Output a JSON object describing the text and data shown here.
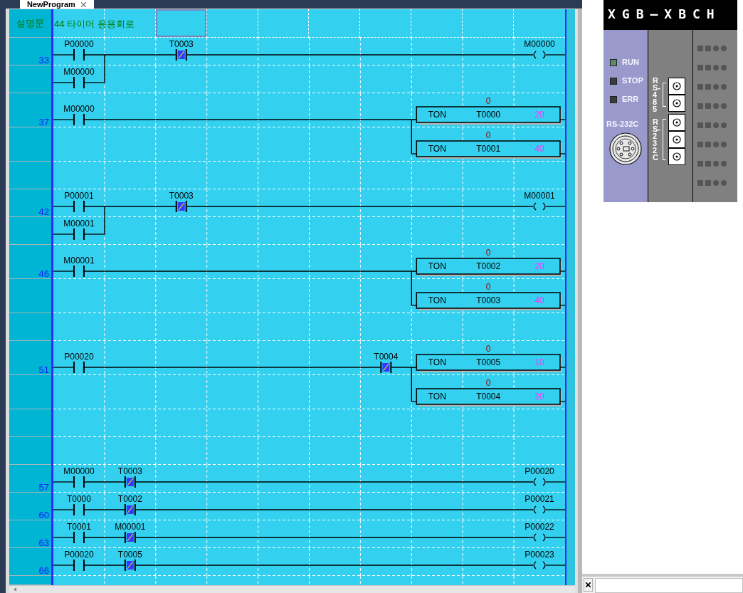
{
  "tab": {
    "title": "NewProgram",
    "selected": true
  },
  "ladder": {
    "rows": [
      {
        "kind": "comment",
        "label": "설명문",
        "text": "44 타이머 응용회로",
        "cells": [
          {
            "kind": "blank",
            "selected": false
          },
          {
            "kind": "blank",
            "selected": false
          },
          {
            "kind": "blank",
            "selected": true
          },
          {
            "kind": "blank",
            "selected": false
          },
          {
            "kind": "blank",
            "selected": false
          },
          {
            "kind": "blank",
            "selected": false
          },
          {
            "kind": "blank",
            "selected": false
          },
          {
            "kind": "blank",
            "selected": false
          },
          {
            "kind": "blank",
            "selected": false
          },
          {
            "kind": "blank",
            "selected": false
          }
        ]
      },
      {
        "kind": "rung",
        "step": "33",
        "cells": [
          {
            "kind": "contact",
            "label": "P00000"
          },
          {
            "kind": "wire"
          },
          {
            "kind": "contact_nc",
            "label": "T0003"
          },
          {
            "kind": "wire"
          },
          {
            "kind": "wire"
          },
          {
            "kind": "wire"
          },
          {
            "kind": "wire"
          },
          {
            "kind": "wire"
          },
          {
            "kind": "wire"
          },
          {
            "kind": "coil",
            "label": "M00000"
          }
        ]
      },
      {
        "kind": "branch",
        "cells": [
          {
            "kind": "contact",
            "label": "M00000"
          },
          {
            "kind": "blank",
            "branch": true
          }
        ]
      },
      {
        "kind": "rung",
        "step": "37",
        "cells": [
          {
            "kind": "contact",
            "label": "M00000"
          },
          {
            "kind": "wire"
          },
          {
            "kind": "wire"
          },
          {
            "kind": "wire"
          },
          {
            "kind": "wire"
          },
          {
            "kind": "wire"
          },
          {
            "kind": "wire"
          },
          {
            "kind": "timer",
            "instruction": "TON",
            "operand": "T0000",
            "preset": "20",
            "current": "0"
          }
        ]
      },
      {
        "kind": "branch",
        "cells": [
          {
            "kind": "blank"
          },
          {
            "kind": "blank"
          },
          {
            "kind": "blank"
          },
          {
            "kind": "blank"
          },
          {
            "kind": "blank"
          },
          {
            "kind": "blank"
          },
          {
            "kind": "blank"
          },
          {
            "kind": "timer",
            "branch": true,
            "instruction": "TON",
            "operand": "T0001",
            "preset": "40",
            "current": "0"
          }
        ]
      },
      {
        "kind": "empty"
      },
      {
        "kind": "rung",
        "step": "42",
        "cells": [
          {
            "kind": "contact",
            "label": "P00001"
          },
          {
            "kind": "wire"
          },
          {
            "kind": "contact_nc",
            "label": "T0003"
          },
          {
            "kind": "wire"
          },
          {
            "kind": "wire"
          },
          {
            "kind": "wire"
          },
          {
            "kind": "wire"
          },
          {
            "kind": "wire"
          },
          {
            "kind": "wire"
          },
          {
            "kind": "coil",
            "label": "M00001"
          }
        ]
      },
      {
        "kind": "branch",
        "cells": [
          {
            "kind": "contact",
            "label": "M00001"
          },
          {
            "kind": "blank",
            "branch": true
          }
        ]
      },
      {
        "kind": "rung",
        "step": "46",
        "cells": [
          {
            "kind": "contact",
            "label": "M00001"
          },
          {
            "kind": "wire"
          },
          {
            "kind": "wire"
          },
          {
            "kind": "wire"
          },
          {
            "kind": "wire"
          },
          {
            "kind": "wire"
          },
          {
            "kind": "wire"
          },
          {
            "kind": "timer",
            "instruction": "TON",
            "operand": "T0002",
            "preset": "20",
            "current": "0"
          }
        ]
      },
      {
        "kind": "branch",
        "cells": [
          {
            "kind": "blank"
          },
          {
            "kind": "blank"
          },
          {
            "kind": "blank"
          },
          {
            "kind": "blank"
          },
          {
            "kind": "blank"
          },
          {
            "kind": "blank"
          },
          {
            "kind": "blank"
          },
          {
            "kind": "timer",
            "branch": true,
            "instruction": "TON",
            "operand": "T0003",
            "preset": "40",
            "current": "0"
          }
        ]
      },
      {
        "kind": "empty"
      },
      {
        "kind": "rung",
        "step": "51",
        "cells": [
          {
            "kind": "contact",
            "label": "P00020"
          },
          {
            "kind": "wire"
          },
          {
            "kind": "wire"
          },
          {
            "kind": "wire"
          },
          {
            "kind": "wire"
          },
          {
            "kind": "wire"
          },
          {
            "kind": "contact_nc",
            "label": "T0004"
          },
          {
            "kind": "timer",
            "instruction": "TON",
            "operand": "T0005",
            "preset": "10",
            "current": "0"
          }
        ]
      },
      {
        "kind": "branch",
        "cells": [
          {
            "kind": "blank"
          },
          {
            "kind": "blank"
          },
          {
            "kind": "blank"
          },
          {
            "kind": "blank"
          },
          {
            "kind": "blank"
          },
          {
            "kind": "blank"
          },
          {
            "kind": "blank"
          },
          {
            "kind": "timer",
            "branch": true,
            "instruction": "TON",
            "operand": "T0004",
            "preset": "20",
            "current": "0"
          }
        ]
      },
      {
        "kind": "empty"
      },
      {
        "kind": "empty"
      },
      {
        "kind": "rung",
        "step": "57",
        "cells": [
          {
            "kind": "contact",
            "label": "M00000"
          },
          {
            "kind": "contact_nc",
            "label": "T0003"
          },
          {
            "kind": "wire"
          },
          {
            "kind": "wire"
          },
          {
            "kind": "wire"
          },
          {
            "kind": "wire"
          },
          {
            "kind": "wire"
          },
          {
            "kind": "wire"
          },
          {
            "kind": "wire"
          },
          {
            "kind": "coil",
            "label": "P00020"
          }
        ]
      },
      {
        "kind": "rung",
        "step": "60",
        "cells": [
          {
            "kind": "contact",
            "label": "T0000"
          },
          {
            "kind": "contact_nc",
            "label": "T0002"
          },
          {
            "kind": "wire"
          },
          {
            "kind": "wire"
          },
          {
            "kind": "wire"
          },
          {
            "kind": "wire"
          },
          {
            "kind": "wire"
          },
          {
            "kind": "wire"
          },
          {
            "kind": "wire"
          },
          {
            "kind": "coil",
            "label": "P00021"
          }
        ]
      },
      {
        "kind": "rung",
        "step": "63",
        "cells": [
          {
            "kind": "contact",
            "label": "T0001"
          },
          {
            "kind": "contact_nc",
            "label": "M00001"
          },
          {
            "kind": "wire"
          },
          {
            "kind": "wire"
          },
          {
            "kind": "wire"
          },
          {
            "kind": "wire"
          },
          {
            "kind": "wire"
          },
          {
            "kind": "wire"
          },
          {
            "kind": "wire"
          },
          {
            "kind": "coil",
            "label": "P00022"
          }
        ]
      },
      {
        "kind": "rung",
        "step": "66",
        "cells": [
          {
            "kind": "contact",
            "label": "P00020"
          },
          {
            "kind": "contact_nc",
            "label": "T0005"
          },
          {
            "kind": "wire"
          },
          {
            "kind": "wire"
          },
          {
            "kind": "wire"
          },
          {
            "kind": "wire"
          },
          {
            "kind": "wire"
          },
          {
            "kind": "wire"
          },
          {
            "kind": "wire"
          },
          {
            "kind": "coil",
            "label": "P00023"
          }
        ]
      },
      {
        "kind": "empty"
      }
    ]
  },
  "plc": {
    "model": "XGB—XBCH",
    "status_leds": [
      {
        "label": "RUN",
        "color": "#5e8a6a"
      },
      {
        "label": "STOP",
        "color": "#3c3c3c"
      },
      {
        "label": "ERR",
        "color": "#3c3c3c"
      }
    ],
    "serial_port_label": "RS-232C",
    "port_groups": [
      {
        "label": "RS-485",
        "kind": "pair"
      },
      {
        "label": "RS-232C",
        "kind": "triple"
      }
    ]
  }
}
